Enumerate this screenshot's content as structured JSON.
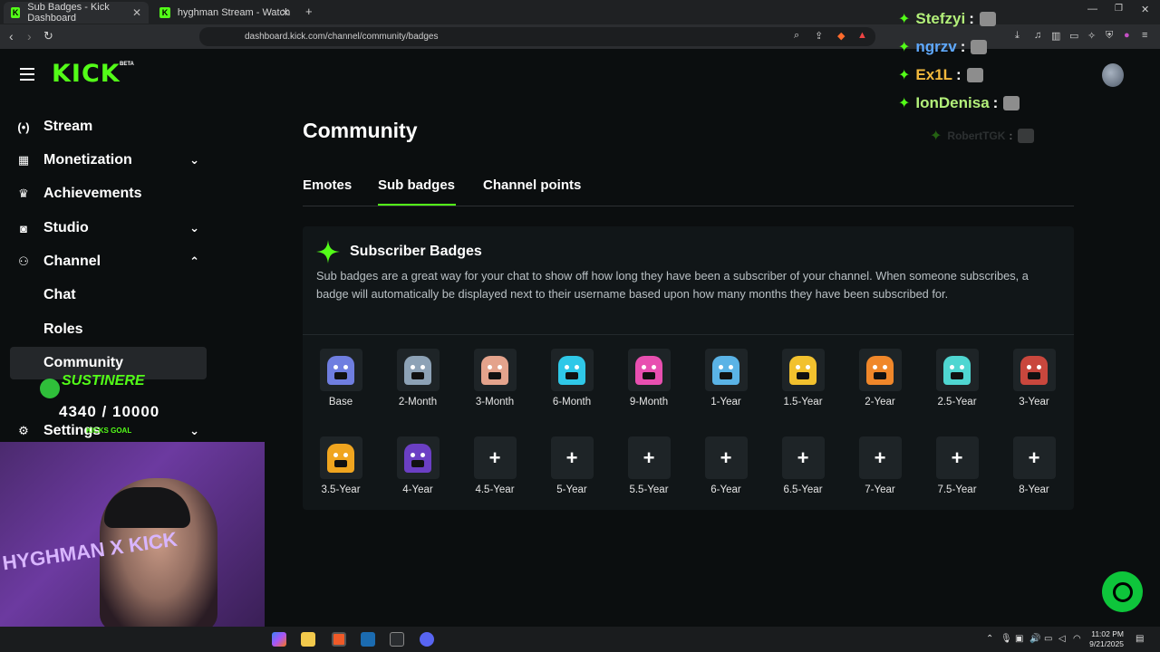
{
  "browser": {
    "tabs": [
      {
        "title": "Sub Badges - Kick Dashboard",
        "active": true
      },
      {
        "title": "hyghman Stream - Watch Live on Kic",
        "active": false
      }
    ],
    "url": "dashboard.kick.com/channel/community/badges"
  },
  "header": {
    "logo": "KICK",
    "beta": "BETA"
  },
  "sidebar": {
    "items": [
      {
        "label": "Stream",
        "icon": "broadcast-icon"
      },
      {
        "label": "Monetization",
        "icon": "money-icon",
        "chevron": "down"
      },
      {
        "label": "Achievements",
        "icon": "trophy-icon"
      },
      {
        "label": "Studio",
        "icon": "studio-icon",
        "chevron": "down"
      },
      {
        "label": "Channel",
        "icon": "users-icon",
        "chevron": "up"
      },
      {
        "label": "Chat"
      },
      {
        "label": "Roles"
      },
      {
        "label": "Community",
        "active": true
      },
      {
        "label": "Settings",
        "icon": "gear-icon",
        "chevron": "down"
      }
    ]
  },
  "main": {
    "title": "Community",
    "tabs": [
      "Emotes",
      "Sub badges",
      "Channel points"
    ],
    "active_tab": "Sub badges",
    "card": {
      "title": "Subscriber Badges",
      "description": "Sub badges are a great way for your chat to show off how long they have been a subscriber of your channel. When someone subscribes, a badge will automatically be displayed next to their username based upon how many months they have been subscribed for."
    },
    "badges": [
      {
        "label": "Base",
        "color": "#6f7ee0"
      },
      {
        "label": "2-Month",
        "color": "#8da2b6"
      },
      {
        "label": "3-Month",
        "color": "#e4a38c"
      },
      {
        "label": "6-Month",
        "color": "#2fc8e8"
      },
      {
        "label": "9-Month",
        "color": "#e84fb0"
      },
      {
        "label": "1-Year",
        "color": "#5ab3e6"
      },
      {
        "label": "1.5-Year",
        "color": "#f2c12e"
      },
      {
        "label": "2-Year",
        "color": "#f0872a"
      },
      {
        "label": "2.5-Year",
        "color": "#4fd6d1"
      },
      {
        "label": "3-Year",
        "color": "#c9473d"
      },
      {
        "label": "3.5-Year",
        "color": "#f0a51f"
      },
      {
        "label": "4-Year",
        "color": "#6b3fc4"
      },
      {
        "label": "4.5-Year",
        "empty": true
      },
      {
        "label": "5-Year",
        "empty": true
      },
      {
        "label": "5.5-Year",
        "empty": true
      },
      {
        "label": "6-Year",
        "empty": true
      },
      {
        "label": "6.5-Year",
        "empty": true
      },
      {
        "label": "7-Year",
        "empty": true
      },
      {
        "label": "7.5-Year",
        "empty": true
      },
      {
        "label": "8-Year",
        "empty": true
      }
    ],
    "plus": "+"
  },
  "overlay_chat": [
    {
      "name": "Stefzyi",
      "color": "#b3f07a"
    },
    {
      "name": "ngrzv",
      "color": "#5fa9ff"
    },
    {
      "name": "Ex1L",
      "color": "#f2b93d"
    },
    {
      "name": "IonDenisa",
      "color": "#b3f07a"
    },
    {
      "name": "RobertTGK",
      "color": "#6b6f72"
    }
  ],
  "stream_overlay": {
    "goal_title": "SUSTINERE",
    "goal_progress": "4340  / 10000",
    "goal_label": "KICKS GOAL",
    "webcam_text": "HYGHMAN X KICK"
  },
  "taskbar": {
    "time": "11:02 PM",
    "date": "9/21/2025"
  }
}
